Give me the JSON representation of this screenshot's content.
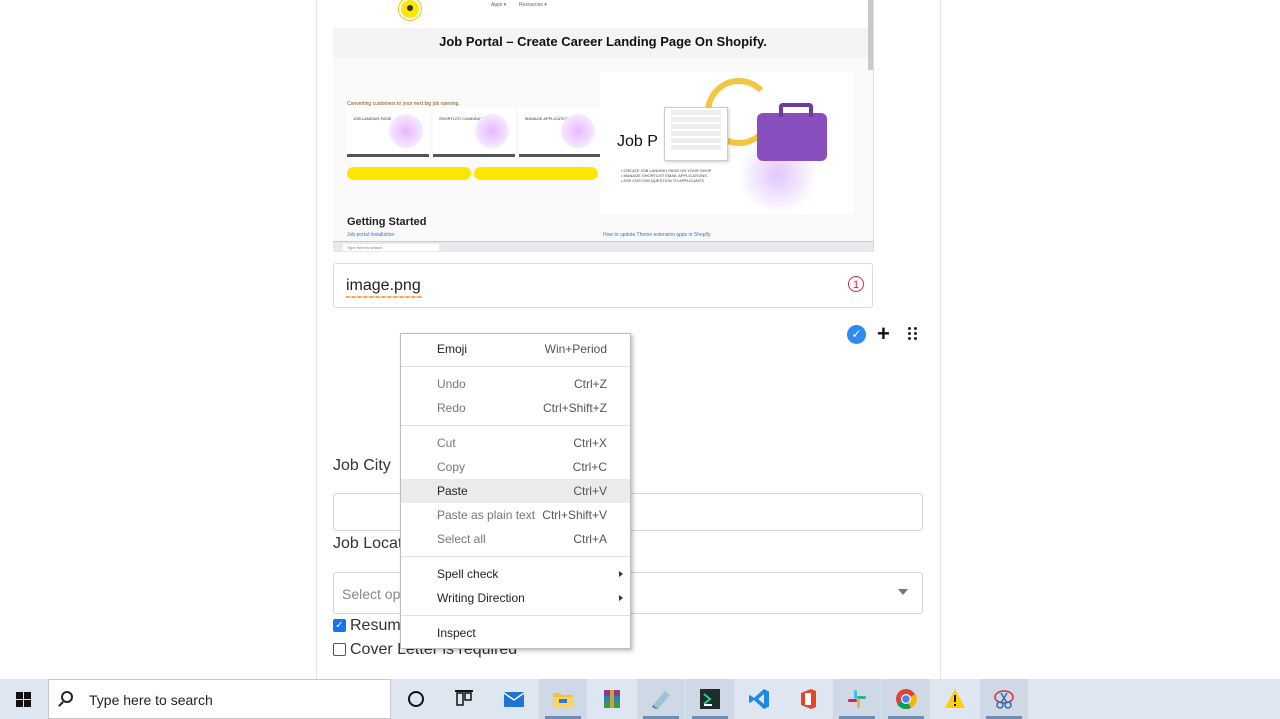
{
  "embedded_screenshot": {
    "nav": [
      "Apps ▾",
      "Resources ▾"
    ],
    "title": "Job Portal – Create Career Landing Page On Shopify.",
    "subline": "Converting customers to your next big job opening.",
    "cards": [
      "JOB LANDING PAGE",
      "SHORTLIST CANDIDATES",
      "MANAGE APPLICATIONS"
    ],
    "right_heading": "Job P",
    "bullets": [
      "• CREATE JOB LANDING PAGE ON YOUR SHOP",
      "• MANAGE SHORTLIST EMAIL APPLICATIONS",
      "• ASK CUSTOM QUESTION TO APPLICANTS"
    ],
    "getting_started": "Getting Started",
    "link_left": "Job portal Installation",
    "link_right": "How to update Theme extension apps in Shopify",
    "mini_search": "Type here to search"
  },
  "file_field": {
    "filename": "image.png",
    "error_badge": "1"
  },
  "actions": {
    "check": "✓",
    "plus": "+"
  },
  "form": {
    "job_city_label": "Job City",
    "job_location_label": "Job Locat",
    "select_placeholder": "Select opt",
    "resume_label": "Resume",
    "resume_checked": true,
    "cover_letter_label": "Cover Letter is required",
    "cover_letter_checked": false
  },
  "context_menu": {
    "items": [
      {
        "label": "Emoji",
        "shortcut": "Win+Period"
      },
      {
        "label": "Undo",
        "shortcut": "Ctrl+Z"
      },
      {
        "label": "Redo",
        "shortcut": "Ctrl+Shift+Z"
      },
      {
        "label": "Cut",
        "shortcut": "Ctrl+X"
      },
      {
        "label": "Copy",
        "shortcut": "Ctrl+C"
      },
      {
        "label": "Paste",
        "shortcut": "Ctrl+V"
      },
      {
        "label": "Paste as plain text",
        "shortcut": "Ctrl+Shift+V"
      },
      {
        "label": "Select all",
        "shortcut": "Ctrl+A"
      },
      {
        "label": "Spell check",
        "shortcut": ""
      },
      {
        "label": "Writing Direction",
        "shortcut": ""
      },
      {
        "label": "Inspect",
        "shortcut": ""
      }
    ],
    "highlighted": "Paste"
  },
  "taskbar": {
    "search_placeholder": "Type here to search",
    "apps": [
      "cortana-icon",
      "task-view-icon",
      "mail-icon",
      "file-explorer-icon",
      "winrar-icon",
      "app-icon",
      "pycharm-icon",
      "vscode-icon",
      "office-icon",
      "slack-icon",
      "chrome-icon",
      "warning-icon",
      "snipping-tool-icon"
    ],
    "active_app": "chrome-icon"
  },
  "colors": {
    "accent_blue": "#2d8bf0",
    "error_red": "#d9254a",
    "taskbar_bg": "#dde6f1",
    "shopify_yellow": "#ffe600"
  }
}
